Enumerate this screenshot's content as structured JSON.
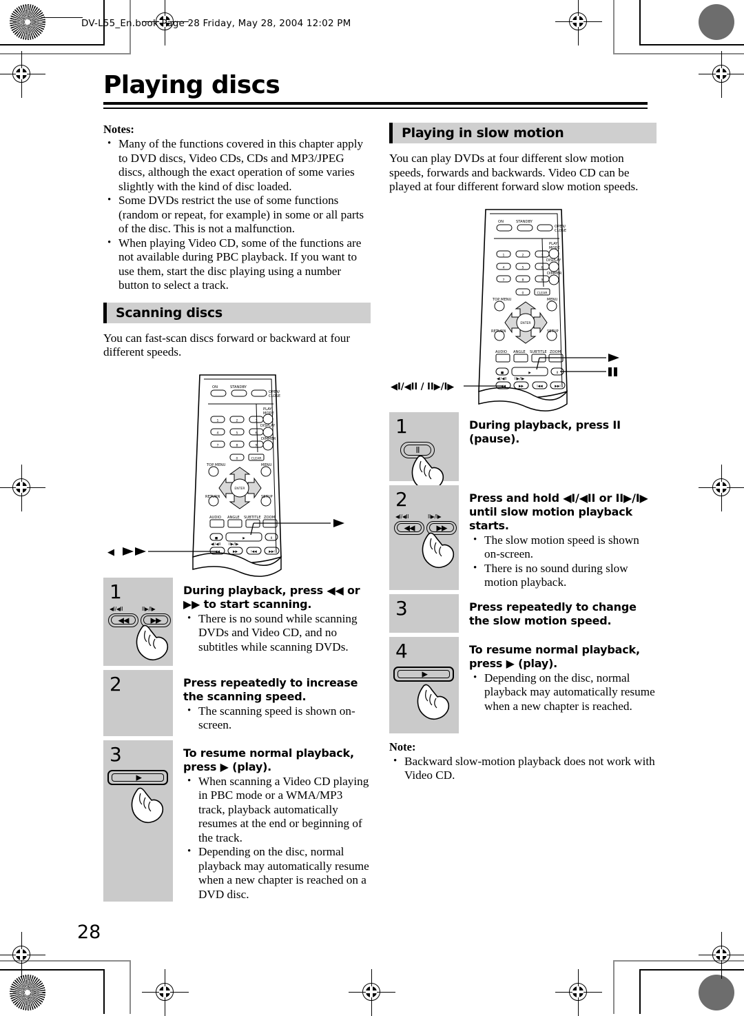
{
  "header": {
    "book_line": "DV-L55_En.book  Page 28  Friday, May 28, 2004  12:02 PM"
  },
  "page_title": "Playing discs",
  "page_number": "28",
  "left_column": {
    "notes_heading": "Notes:",
    "notes": [
      "Many of the functions covered in this chapter apply to DVD discs, Video CDs, CDs and MP3/JPEG discs, although the exact operation of some varies slightly with the kind of disc loaded.",
      "Some DVDs restrict the use of some functions (random or repeat, for example) in some or all parts of the disc. This is not a malfunction.",
      "When playing Video CD, some of the functions are not available during PBC playback. If you want to use them, start the disc playing using a number button to select a track."
    ],
    "section_heading": "Scanning discs",
    "intro": "You can fast-scan discs forward or backward at four different speeds.",
    "remote_callout_left": "◀◀/▶▶",
    "remote_callout_right": "▶",
    "steps": [
      {
        "number": "1",
        "title": "During playback, press ◀◀ or ▶▶ to start scanning.",
        "bullets": [
          "There is no sound while scanning DVDs and Video CD, and no subtitles while scanning DVDs."
        ],
        "graphic": "rev-fwd-buttons",
        "btn_label_left": "◀I/◀II",
        "btn_label_right": "II▶/I▶"
      },
      {
        "number": "2",
        "title": "Press repeatedly to increase the scanning speed.",
        "bullets": [
          "The scanning speed is shown on-screen."
        ],
        "graphic": "none"
      },
      {
        "number": "3",
        "title": "To resume normal playback, press ▶ (play).",
        "bullets": [
          "When scanning a Video CD playing in PBC mode or a WMA/MP3 track, playback automatically resumes at the end or beginning of the track.",
          "Depending on the disc, normal playback may automatically resume when a new chapter is reached on a DVD disc."
        ],
        "graphic": "play-button"
      }
    ]
  },
  "right_column": {
    "section_heading": "Playing in slow motion",
    "intro": "You can play DVDs at four different slow motion speeds, forwards and backwards. Video CD can be played at four different forward slow motion speeds.",
    "remote_callout_left": "◀I/◀II / II▶/I▶",
    "remote_callout_play": "▶",
    "remote_callout_pause": "II",
    "steps": [
      {
        "number": "1",
        "title": "During playback, press II (pause).",
        "bullets": [],
        "graphic": "pause-button"
      },
      {
        "number": "2",
        "title": "Press and hold ◀I/◀II or II▶/I▶ until slow motion playback starts.",
        "bullets": [
          "The slow motion speed is shown on-screen.",
          "There is no sound during slow motion playback."
        ],
        "graphic": "rev-fwd-buttons",
        "btn_label_left": "◀I/◀II",
        "btn_label_right": "II▶/I▶"
      },
      {
        "number": "3",
        "title": "Press repeatedly to change the slow motion speed.",
        "bullets": [],
        "graphic": "none"
      },
      {
        "number": "4",
        "title": "To resume normal playback, press ▶ (play).",
        "bullets": [
          "Depending on the disc, normal playback may automatically resume when a new chapter is reached."
        ],
        "graphic": "play-button"
      }
    ],
    "note_heading": "Note:",
    "notes": [
      "Backward slow-motion playback does not work with Video CD."
    ]
  },
  "remote": {
    "labels": {
      "on": "ON",
      "standby": "STANDBY",
      "open_close_1": "OPEN/",
      "open_close_2": "CLOSE",
      "play_mode_1": "PLAY",
      "play_mode_2": "MODE",
      "display": "DISPLAY",
      "dimmer": "DIMMER",
      "top_menu": "TOP MENU",
      "menu": "MENU",
      "return": "RETURN",
      "setup": "SETUP",
      "enter": "ENTER",
      "audio": "AUDIO",
      "angle": "ANGLE",
      "subtitle": "SUBTITLE",
      "zoom": "ZOOM",
      "clear": "CLEAR"
    },
    "numbers": [
      "1",
      "2",
      "3",
      "4",
      "5",
      "6",
      "7",
      "8",
      "9",
      "0"
    ]
  },
  "colors": {
    "step_gray": "#cacaca",
    "section_gray": "#cfcfcf",
    "ink": "#000000"
  }
}
